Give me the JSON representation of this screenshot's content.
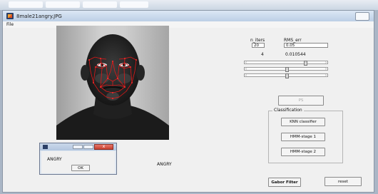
{
  "window": {
    "title": "8male21angry.JPG",
    "controls": ""
  },
  "menu": {
    "file": "File"
  },
  "params": {
    "n_iters_label": "n_iters",
    "rms_err_label": "RMS_err",
    "n_iters_value": "20",
    "rms_err_value": "0.05",
    "n_iters_result": "4",
    "rms_err_result": "0.010544"
  },
  "sliders": [
    {
      "level": 0.72
    },
    {
      "level": 0.5
    },
    {
      "level": 0.5
    }
  ],
  "ps_button": "PS",
  "classification": {
    "title": "Classification",
    "knn": "KNN classifier",
    "hmm1": "HMM-stage 1",
    "hmm2": "HMM-stage 2"
  },
  "result_text": "ANGRY",
  "gabor_button": "Gabor Filter",
  "reset_button": "reset",
  "dialog": {
    "message": "ANGRY",
    "ok": "OK",
    "close": "x"
  }
}
